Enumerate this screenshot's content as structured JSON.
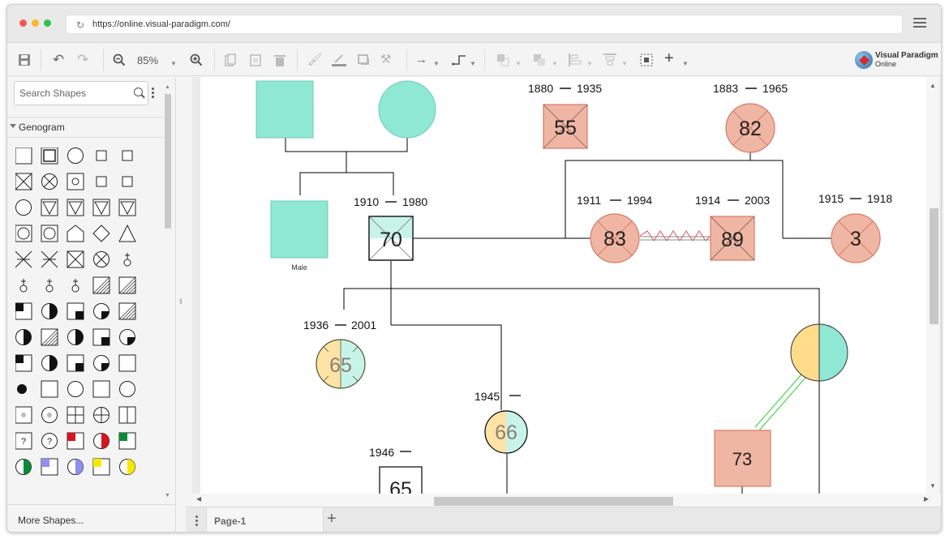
{
  "browser": {
    "url": "https://online.visual-paradigm.com/",
    "traffic_light_colors": [
      "#f45d52",
      "#f8b82e",
      "#2fc54a"
    ]
  },
  "toolbar": {
    "zoom_level": "85%",
    "icons": [
      "save-icon",
      "undo-icon",
      "redo-icon",
      "zoom-out-icon",
      "zoom-in-icon",
      "copy-icon",
      "paste-icon",
      "delete-icon",
      "fill-color-icon",
      "line-color-icon",
      "shadow-icon",
      "format-painter-icon",
      "connector-style-icon",
      "waypoint-style-icon",
      "group-icon",
      "arrange-icon",
      "align-icon",
      "distribute-icon",
      "select-area-icon",
      "add-icon"
    ]
  },
  "logo": {
    "line1": "Visual Paradigm",
    "line2": "Online"
  },
  "sidebar": {
    "search_placeholder": "Search Shapes",
    "category": "Genogram",
    "more_shapes": "More Shapes...",
    "shape_rows": 13,
    "shape_cols": 5
  },
  "pages": {
    "active_tab": "Page-1"
  },
  "diagram": {
    "colors": {
      "teal": "#8fe8d4",
      "salmon": "#efb6a3",
      "salmon_stroke": "#d77b67",
      "yellow": "#ffdb8a",
      "line": "#000000",
      "green_relation": "#32cd32",
      "red_relation": "#e0505a"
    },
    "persons": [
      {
        "id": "p1",
        "shape": "square",
        "fill": "teal",
        "label": "",
        "years": ""
      },
      {
        "id": "p2",
        "shape": "circle",
        "fill": "teal",
        "label": "",
        "years": ""
      },
      {
        "id": "p3",
        "shape": "square",
        "fill": "teal",
        "caption": "Male"
      },
      {
        "id": "p4",
        "shape": "square",
        "fill": "half-teal",
        "number": "70",
        "born": "1910",
        "died": "1980"
      },
      {
        "id": "p5",
        "shape": "square",
        "fill": "salmon",
        "deceased": true,
        "number": "55",
        "born": "1880",
        "died": "1935"
      },
      {
        "id": "p6",
        "shape": "circle",
        "fill": "salmon",
        "deceased": true,
        "number": "82",
        "born": "1883",
        "died": "1965"
      },
      {
        "id": "p7",
        "shape": "circle",
        "fill": "salmon",
        "deceased": true,
        "number": "83",
        "born": "1911",
        "died": "1994"
      },
      {
        "id": "p8",
        "shape": "square",
        "fill": "salmon",
        "deceased": true,
        "number": "89",
        "born": "1914",
        "died": "2003"
      },
      {
        "id": "p9",
        "shape": "circle",
        "fill": "salmon",
        "deceased": true,
        "number": "3",
        "born": "1915",
        "died": "1918"
      },
      {
        "id": "p10",
        "shape": "circle",
        "fill": "split",
        "number": "65",
        "born": "1936",
        "died": "2001"
      },
      {
        "id": "p11",
        "shape": "circle",
        "fill": "split",
        "number": "66",
        "born": "1945",
        "died": ""
      },
      {
        "id": "p12",
        "shape": "square",
        "fill": "white",
        "number": "65",
        "born": "1946",
        "died": ""
      },
      {
        "id": "p13",
        "shape": "circle",
        "fill": "split",
        "number": "",
        "born": "",
        "died": ""
      },
      {
        "id": "p14",
        "shape": "square",
        "fill": "salmon",
        "number": "73",
        "born": "",
        "died": ""
      }
    ]
  }
}
